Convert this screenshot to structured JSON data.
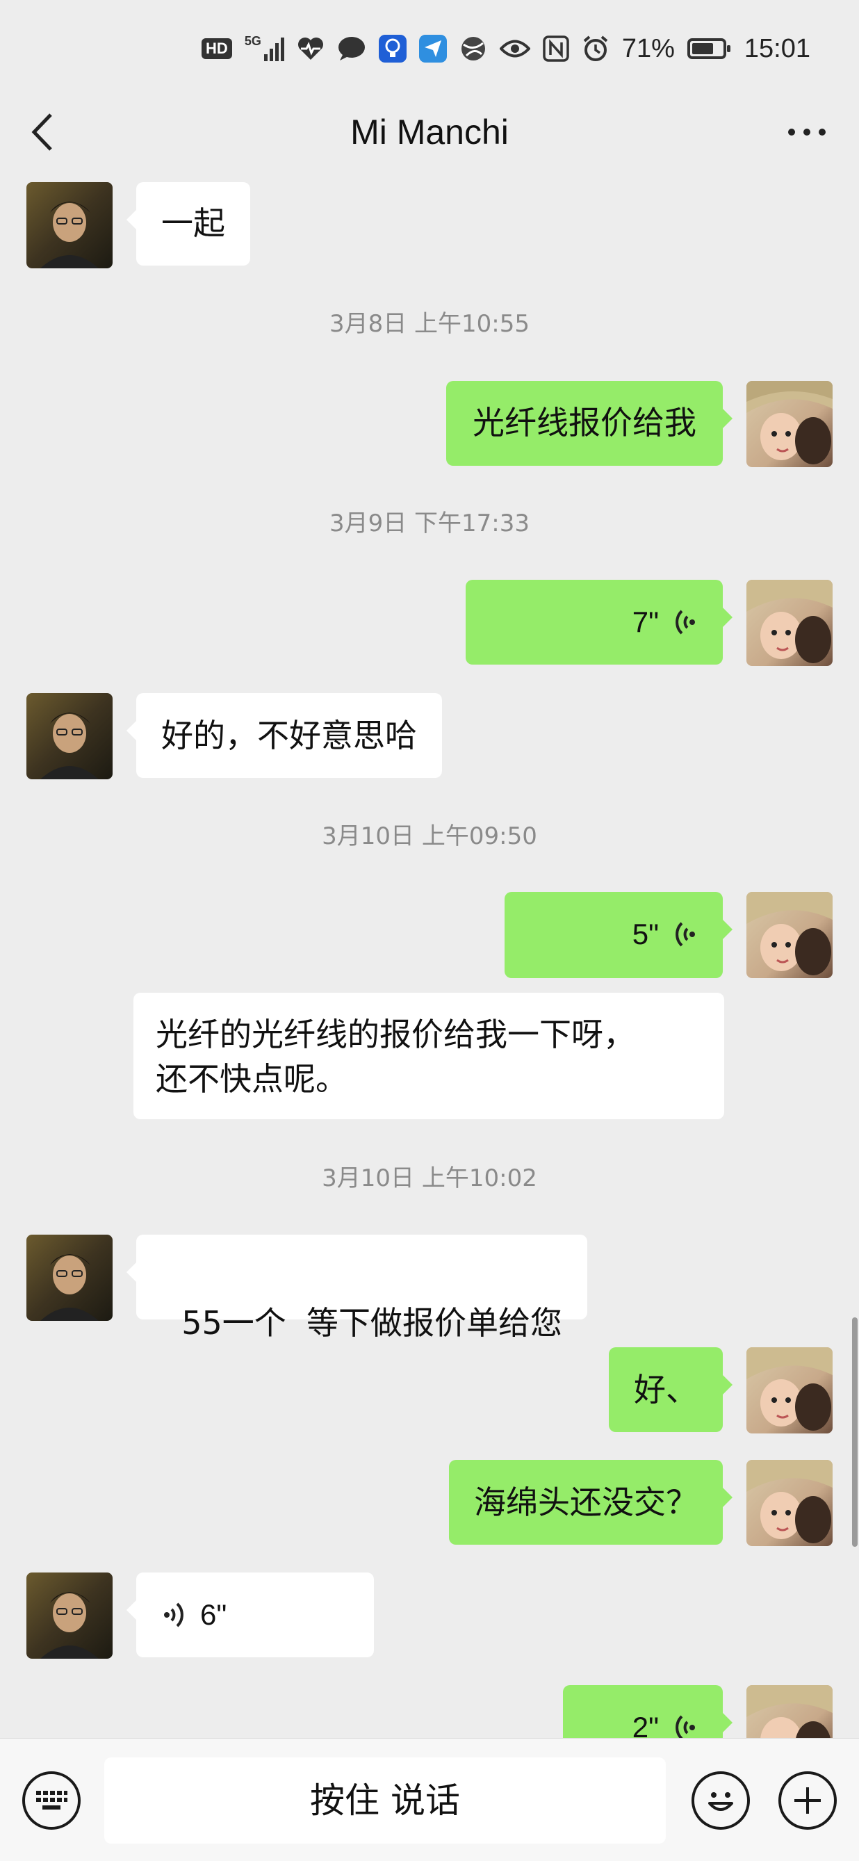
{
  "status_bar": {
    "hd_label": "HD",
    "network_label": "5G",
    "battery_percent": "71%",
    "battery_level": 0.71,
    "time": "15:01",
    "icons": [
      "hd-icon",
      "signal-icon",
      "heart-rate-icon",
      "message-icon",
      "bulb-app-icon",
      "send-app-icon",
      "globe-app-icon",
      "eye-icon",
      "nfc-icon",
      "alarm-icon",
      "battery-icon"
    ]
  },
  "nav": {
    "title": "Mi Manchi",
    "back_icon": "chevron-left-icon",
    "more_icon": "more-dots-icon"
  },
  "messages": {
    "m1": {
      "side": "in",
      "type": "text",
      "text": "一起"
    },
    "t1": "3月8日 上午10:55",
    "m2": {
      "side": "out",
      "type": "text",
      "text": "光纤线报价给我"
    },
    "t2": "3月9日 下午17:33",
    "m3": {
      "side": "out",
      "type": "voice",
      "duration": "7\""
    },
    "m4": {
      "side": "in",
      "type": "text",
      "text": "好的，不好意思哈"
    },
    "t3": "3月10日 上午09:50",
    "m5": {
      "side": "out",
      "type": "voice",
      "duration": "5\""
    },
    "m5_transcript": {
      "line1": "光纤的光纤线的报价给我一下呀，",
      "line2": "还不快点呢。"
    },
    "t4": "3月10日 上午10:02",
    "m6": {
      "side": "in",
      "type": "text",
      "text": "55一个  等下做报价单给您"
    },
    "m7": {
      "side": "out",
      "type": "text",
      "text": "好、"
    },
    "m8": {
      "side": "out",
      "type": "text",
      "text": "海绵头还没交？"
    },
    "m9": {
      "side": "in",
      "type": "voice",
      "duration": "6\""
    },
    "m10": {
      "side": "out",
      "type": "voice",
      "duration": "2\""
    }
  },
  "input_bar": {
    "keyboard_icon": "keyboard-icon",
    "hold_to_talk": "按住 说话",
    "emoji_icon": "emoji-icon",
    "plus_icon": "plus-icon"
  },
  "colors": {
    "background": "#ededed",
    "outgoing_bubble": "#95ec69",
    "incoming_bubble": "#ffffff",
    "timestamp_text": "#8a8a8a"
  }
}
